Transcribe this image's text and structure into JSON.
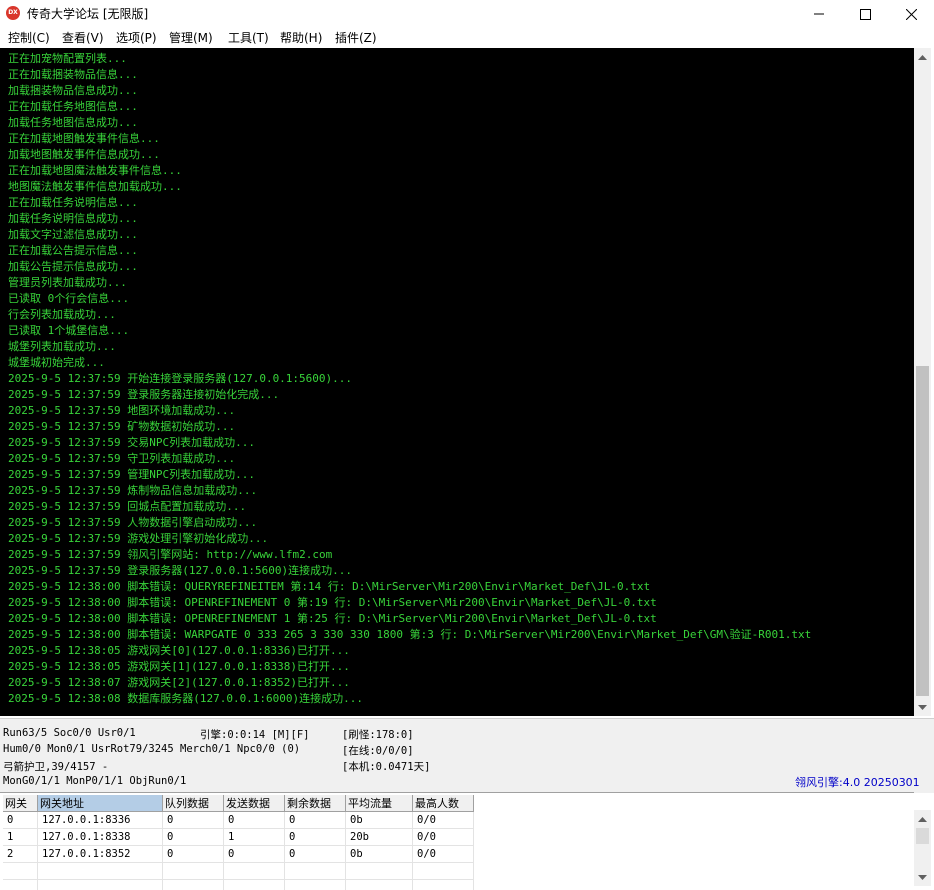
{
  "window": {
    "title": "传奇大学论坛 [无限版]",
    "icon_label": "DX",
    "icon_color": "#d9362b"
  },
  "menu": [
    "控制(C)",
    "查看(V)",
    "选项(P)",
    "管理(M)",
    "工具(T)",
    "帮助(H)",
    "插件(Z)"
  ],
  "console": {
    "text_color": "#38d43a",
    "background": "#000000",
    "lines": [
      "正在加宠物配置列表...",
      "正在加载捆装物品信息...",
      "加载捆装物品信息成功...",
      "正在加载任务地图信息...",
      "加载任务地图信息成功...",
      "正在加载地图触发事件信息...",
      "加载地图触发事件信息成功...",
      "正在加载地图魔法触发事件信息...",
      "地图魔法触发事件信息加载成功...",
      "正在加载任务说明信息...",
      "加载任务说明信息成功...",
      "加载文字过滤信息成功...",
      "正在加载公告提示信息...",
      "加载公告提示信息成功...",
      "管理员列表加载成功...",
      "已读取 0个行会信息...",
      "行会列表加载成功...",
      "已读取 1个城堡信息...",
      "城堡列表加载成功...",
      "城堡城初始完成...",
      "2025-9-5 12:37:59 开始连接登录服务器(127.0.0.1:5600)...",
      "2025-9-5 12:37:59 登录服务器连接初始化完成...",
      "2025-9-5 12:37:59 地图环境加载成功...",
      "2025-9-5 12:37:59 矿物数据初始成功...",
      "2025-9-5 12:37:59 交易NPC列表加载成功...",
      "2025-9-5 12:37:59 守卫列表加载成功...",
      "2025-9-5 12:37:59 管理NPC列表加载成功...",
      "2025-9-5 12:37:59 炼制物品信息加载成功...",
      "2025-9-5 12:37:59 回城点配置加载成功...",
      "2025-9-5 12:37:59 人物数据引擎启动成功...",
      "2025-9-5 12:37:59 游戏处理引擎初始化成功...",
      "2025-9-5 12:37:59 翎风引擎网站: http://www.lfm2.com",
      "2025-9-5 12:37:59 登录服务器(127.0.0.1:5600)连接成功...",
      "2025-9-5 12:38:00 脚本错误: QUERYREFINEITEM 第:14 行: D:\\MirServer\\Mir200\\Envir\\Market_Def\\JL-0.txt",
      "2025-9-5 12:38:00 脚本错误: OPENREFINEMENT 0 第:19 行: D:\\MirServer\\Mir200\\Envir\\Market_Def\\JL-0.txt",
      "2025-9-5 12:38:00 脚本错误: OPENREFINEMENT 1 第:25 行: D:\\MirServer\\Mir200\\Envir\\Market_Def\\JL-0.txt",
      "2025-9-5 12:38:00 脚本错误: WARPGATE 0 333 265 3 330 330 1800 第:3 行: D:\\MirServer\\Mir200\\Envir\\Market_Def\\GM\\验证-R001.txt",
      "2025-9-5 12:38:05 游戏网关[0](127.0.0.1:8336)已打开...",
      "2025-9-5 12:38:05 游戏网关[1](127.0.0.1:8338)已打开...",
      "2025-9-5 12:38:07 游戏网关[2](127.0.0.1:8352)已打开...",
      "2025-9-5 12:38:08 数据库服务器(127.0.0.1:6000)连接成功..."
    ]
  },
  "status": {
    "run": "Run63/5 Soc0/0 Usr0/1",
    "engine": "引擎:0:0:14 [M][F]",
    "refresh_monster": "[刷怪:178:0]",
    "hum": "Hum0/0 Mon0/1 UsrRot79/3245 Merch0/1 Npc0/0 (0)",
    "online": "[在线:0/0/0]",
    "guard": "弓箭护卫,39/4157 -",
    "local": "[本机:0.0471天]",
    "mong": "MonG0/1/1 MonP0/1/1 ObjRun0/1",
    "version": "翎风引擎:4.0 20250301",
    "version_color": "#0000c8"
  },
  "gateway_table": {
    "headers": [
      "网关",
      "网关地址",
      "队列数据",
      "发送数据",
      "剩余数据",
      "平均流量",
      "最高人数"
    ],
    "rows": [
      [
        "0",
        "127.0.0.1:8336",
        "0",
        "0",
        "0",
        "0b",
        "0/0"
      ],
      [
        "1",
        "127.0.0.1:8338",
        "0",
        "1",
        "0",
        "20b",
        "0/0"
      ],
      [
        "2",
        "127.0.0.1:8352",
        "0",
        "0",
        "0",
        "0b",
        "0/0"
      ]
    ]
  }
}
